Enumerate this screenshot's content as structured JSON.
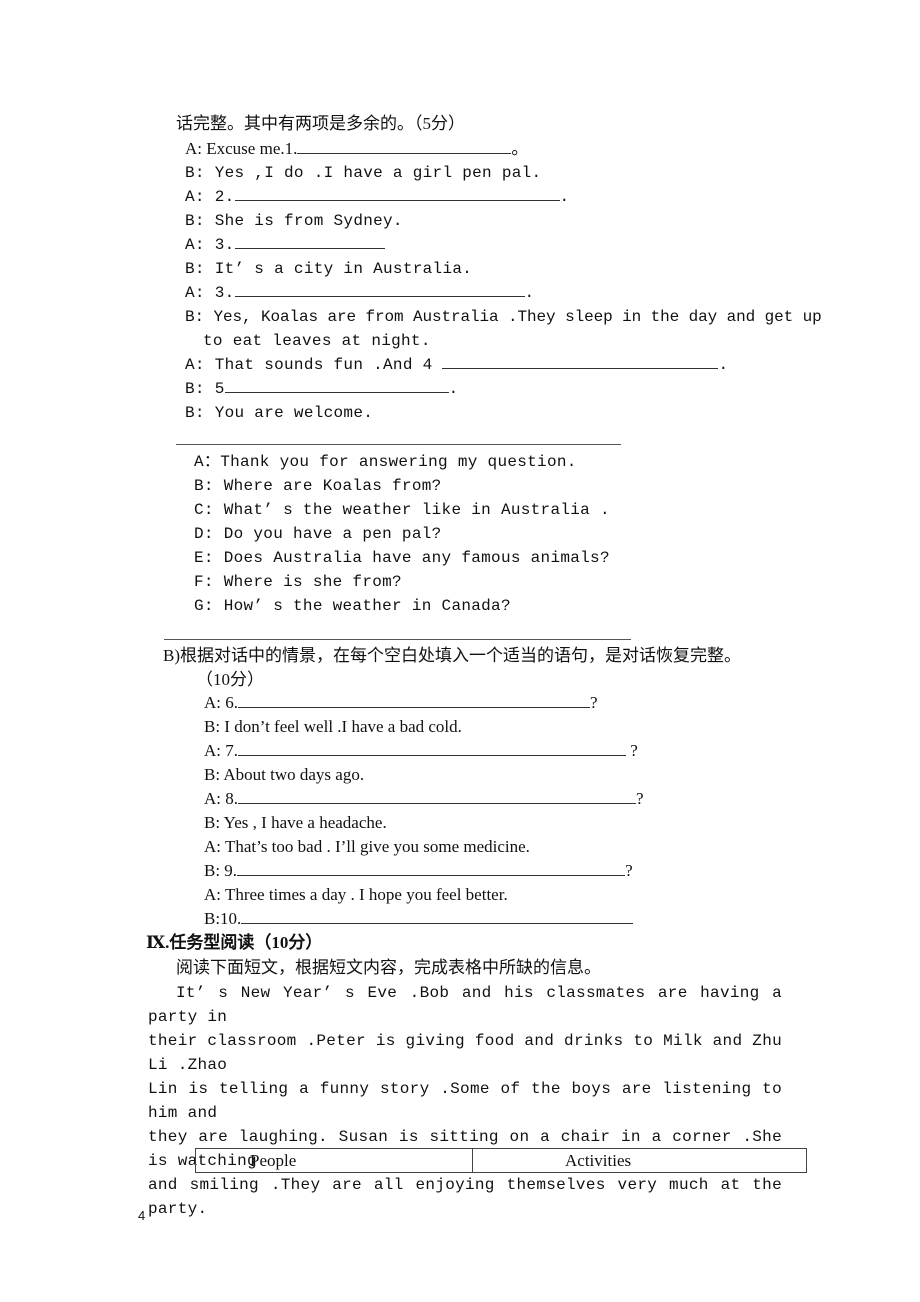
{
  "section_a": {
    "instruction_tail": "话完整。其中有两项是多余的。（5分）",
    "dialogue": [
      {
        "prefix": "A: Excuse me.1.",
        "suffix": "。"
      },
      {
        "text": "B: Yes ,I do .I have a girl pen pal."
      },
      {
        "prefix": "A: 2.",
        "suffix": "."
      },
      {
        "text": "B: She is from Sydney."
      },
      {
        "prefix": "A: 3.",
        "suffix": ""
      },
      {
        "text": "B: It’ s a city in Australia."
      },
      {
        "prefix": "A: 3.",
        "suffix": "."
      },
      {
        "text": "B: Yes, Koalas are from Australia .They sleep in the day and get up"
      },
      {
        "text": "to eat leaves at night."
      },
      {
        "prefix": "A: That sounds fun .And 4 ",
        "suffix": "."
      },
      {
        "prefix": "B: 5",
        "suffix": "."
      },
      {
        "text": "B: You are welcome."
      }
    ],
    "options": [
      "A：Thank you for answering my question.",
      "B: Where are Koalas from?",
      "C: What’ s the weather like in Australia .",
      "D: Do you have a pen pal?",
      "E: Does Australia have any famous animals?",
      "F: Where is she from?",
      "G: How’ s the weather in Canada?"
    ]
  },
  "section_b": {
    "instruction": "B)根据对话中的情景，在每个空白处填入一个适当的语句，是对话恢复完整。",
    "score": "（10分）",
    "dialogue": [
      {
        "prefix": "A: 6.",
        "suffix": "?"
      },
      {
        "text": "B: I don’t feel well .I have a bad cold."
      },
      {
        "prefix": "A: 7.",
        "suffix": " ?"
      },
      {
        "text": "B: About two days ago."
      },
      {
        "prefix": "A: 8.",
        "suffix": "?"
      },
      {
        "text": "B: Yes , I have a headache."
      },
      {
        "text": "A: That’s too bad . I’ll give you some medicine."
      },
      {
        "prefix": "B: 9.",
        "suffix": "?"
      },
      {
        "text": "A: Three times a day . I hope you feel better."
      },
      {
        "prefix": "B:10.",
        "suffix": ""
      }
    ]
  },
  "section_ix": {
    "heading": "Ⅸ.任务型阅读（10分）",
    "instruction": "阅读下面短文，根据短文内容，完成表格中所缺的信息。",
    "passage_lines": [
      "It’ s New Year’ s Eve .Bob and his classmates are having a party in",
      "their classroom .Peter is giving food and drinks to Milk and Zhu Li .Zhao",
      "Lin is telling a funny story .Some of the boys are listening to him and",
      "they are laughing. Susan is sitting on a chair in a corner .She is watching",
      "and smiling .They are all enjoying themselves very much at the party."
    ],
    "table_headers": [
      "People",
      "Activities"
    ]
  },
  "page_number": "4"
}
